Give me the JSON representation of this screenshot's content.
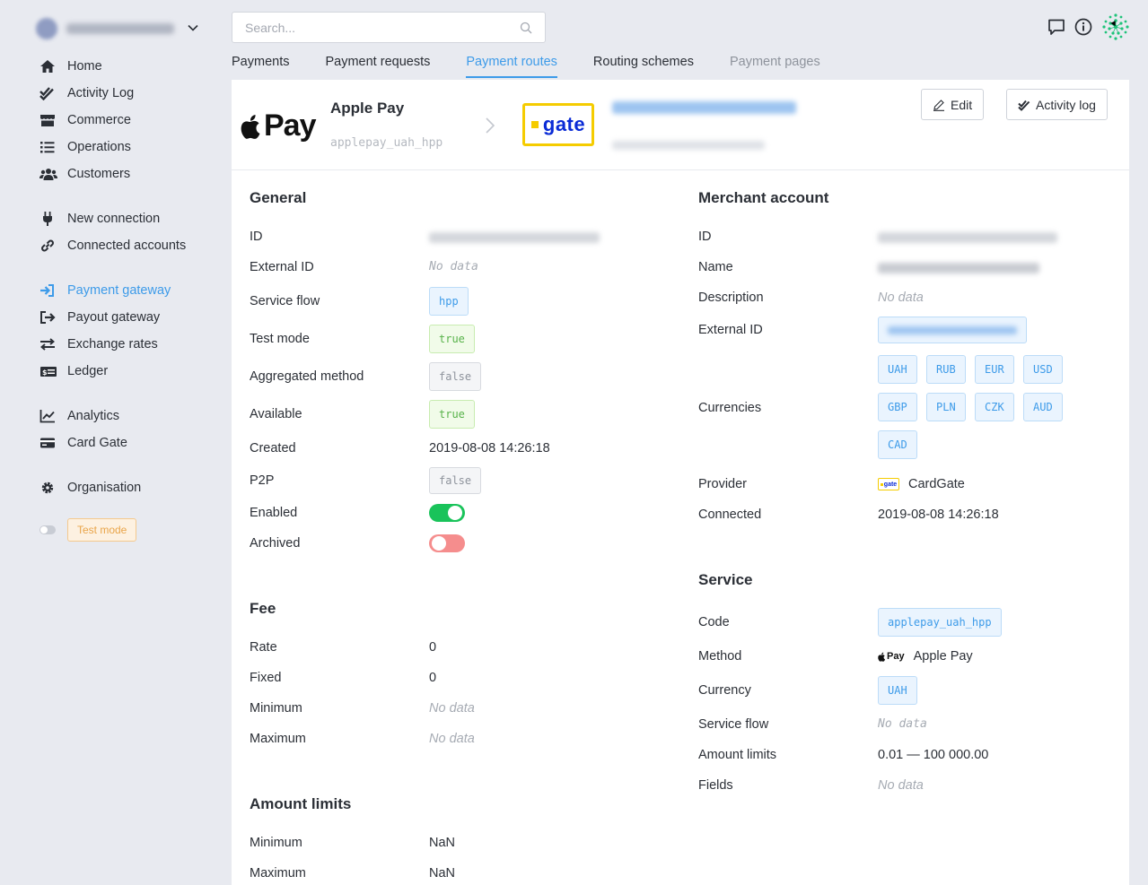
{
  "search": {
    "placeholder": "Search..."
  },
  "tabs": [
    {
      "label": "Payments"
    },
    {
      "label": "Payment requests"
    },
    {
      "label": "Payment routes"
    },
    {
      "label": "Routing schemes"
    },
    {
      "label": "Payment pages"
    }
  ],
  "sidebar": {
    "items": [
      {
        "label": "Home",
        "icon": "home-icon"
      },
      {
        "label": "Activity Log",
        "icon": "double-check-icon"
      },
      {
        "label": "Commerce",
        "icon": "store-icon"
      },
      {
        "label": "Operations",
        "icon": "list-icon"
      },
      {
        "label": "Customers",
        "icon": "users-icon"
      },
      {
        "label": "New connection",
        "icon": "plug-icon"
      },
      {
        "label": "Connected accounts",
        "icon": "link-icon"
      },
      {
        "label": "Payment gateway",
        "icon": "sign-in-icon",
        "active": true
      },
      {
        "label": "Payout gateway",
        "icon": "sign-out-icon"
      },
      {
        "label": "Exchange rates",
        "icon": "exchange-icon"
      },
      {
        "label": "Ledger",
        "icon": "money-icon"
      },
      {
        "label": "Analytics",
        "icon": "chart-line-icon"
      },
      {
        "label": "Card Gate",
        "icon": "credit-card-icon"
      },
      {
        "label": "Organisation",
        "icon": "cog-icon"
      }
    ],
    "test_mode": "Test mode"
  },
  "header": {
    "method_logo_text": "Pay",
    "route_name": "Apple Pay",
    "route_code": "applepay_uah_hpp",
    "provider_logo_text": "gate",
    "edit_label": "Edit",
    "activity_log_label": "Activity log"
  },
  "general": {
    "title": "General",
    "id_label": "ID",
    "external_id_label": "External ID",
    "external_id_value": "No data",
    "service_flow_label": "Service flow",
    "service_flow_value": "hpp",
    "test_mode_label": "Test mode",
    "test_mode_value": "true",
    "aggregated_label": "Aggregated method",
    "aggregated_value": "false",
    "available_label": "Available",
    "available_value": "true",
    "created_label": "Created",
    "created_value": "2019-08-08 14:26:18",
    "p2p_label": "P2P",
    "p2p_value": "false",
    "enabled_label": "Enabled",
    "archived_label": "Archived"
  },
  "fee": {
    "title": "Fee",
    "rate_label": "Rate",
    "rate_value": "0",
    "fixed_label": "Fixed",
    "fixed_value": "0",
    "minimum_label": "Minimum",
    "minimum_value": "No data",
    "maximum_label": "Maximum",
    "maximum_value": "No data"
  },
  "amount_limits": {
    "title": "Amount limits",
    "minimum_label": "Minimum",
    "minimum_value": "NaN",
    "maximum_label": "Maximum",
    "maximum_value": "NaN"
  },
  "merchant": {
    "title": "Merchant account",
    "id_label": "ID",
    "name_label": "Name",
    "description_label": "Description",
    "description_value": "No data",
    "external_id_label": "External ID",
    "currencies_label": "Currencies",
    "currencies": [
      "UAH",
      "RUB",
      "EUR",
      "USD",
      "GBP",
      "PLN",
      "CZK",
      "AUD",
      "CAD"
    ],
    "provider_label": "Provider",
    "provider_logo_text": "gate",
    "provider_value": "CardGate",
    "connected_label": "Connected",
    "connected_value": "2019-08-08 14:26:18"
  },
  "service": {
    "title": "Service",
    "code_label": "Code",
    "code_value": "applepay_uah_hpp",
    "method_label": "Method",
    "method_logo_text": "Pay",
    "method_value": "Apple Pay",
    "currency_label": "Currency",
    "currency_value": "UAH",
    "service_flow_label": "Service flow",
    "service_flow_value": "No data",
    "amount_limits_label": "Amount limits",
    "amount_limits_value": "0.01 — 100 000.00",
    "fields_label": "Fields",
    "fields_value": "No data"
  },
  "colors": {
    "accent": "#3d9be9",
    "switch_on": "#19c35a",
    "switch_off": "#f58d8d",
    "gate_yellow": "#f5cc00",
    "gate_blue": "#0a2bd6"
  }
}
